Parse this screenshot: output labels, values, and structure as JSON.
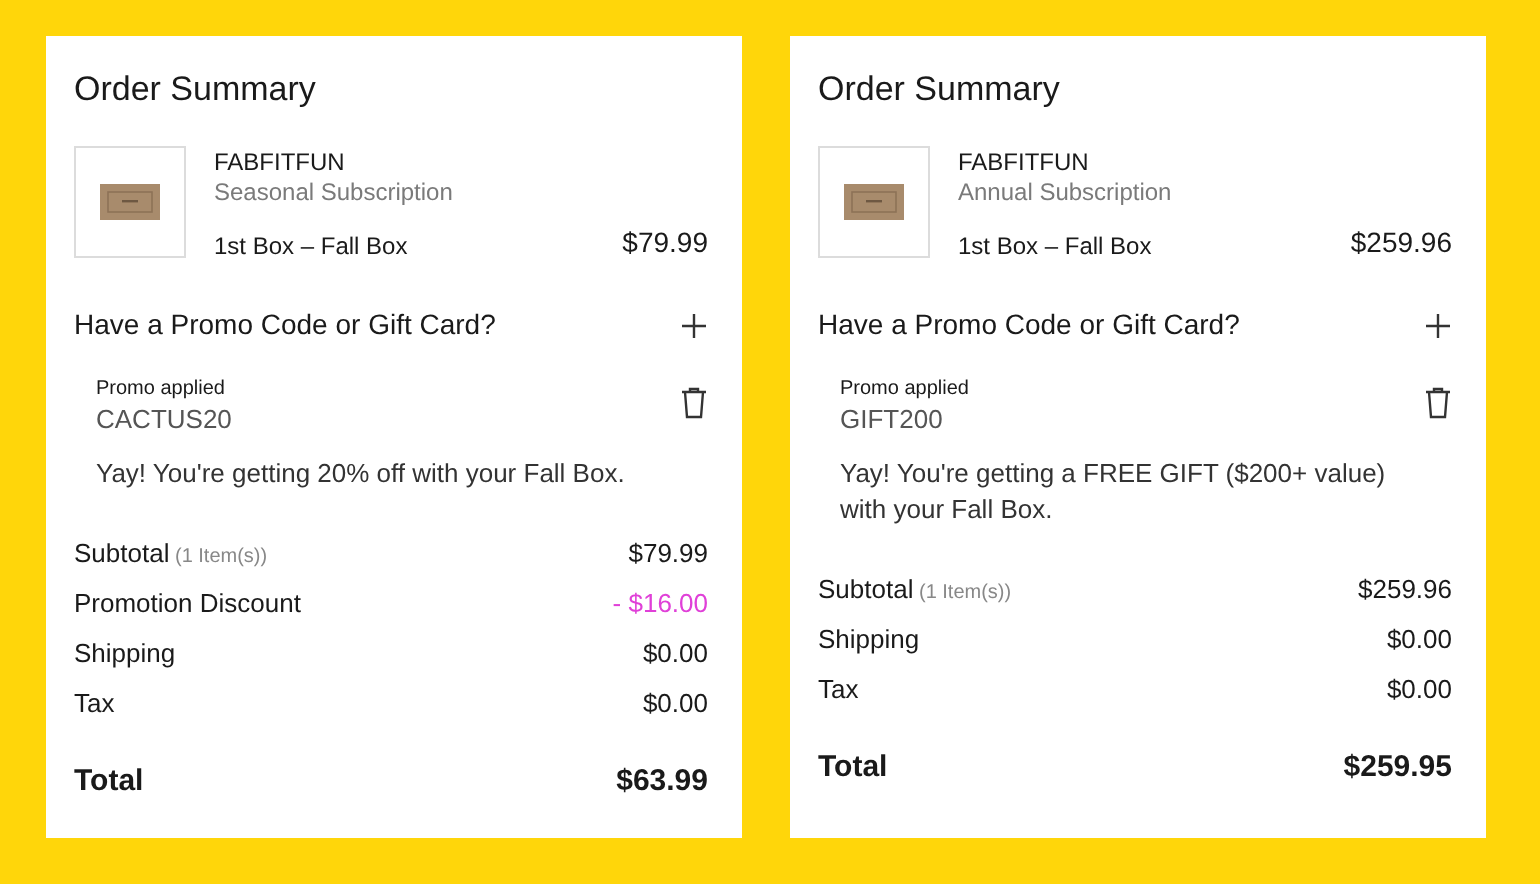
{
  "cards": [
    {
      "title": "Order Summary",
      "brand": "FABFITFUN",
      "plan": "Seasonal Subscription",
      "box": "1st Box – Fall Box",
      "price": "$79.99",
      "promo_prompt": "Have a Promo Code or Gift Card?",
      "promo_label": "Promo applied",
      "promo_code": "CACTUS20",
      "message": "Yay! You're getting 20% off with your Fall Box.",
      "lines": [
        {
          "kind": "normal",
          "label": "Subtotal",
          "note": "(1 Item(s))",
          "value": "$79.99"
        },
        {
          "kind": "discount",
          "label": "Promotion Discount",
          "value": "- $16.00"
        },
        {
          "kind": "normal",
          "label": "Shipping",
          "value": "$0.00"
        },
        {
          "kind": "normal",
          "label": "Tax",
          "value": "$0.00"
        }
      ],
      "total_label": "Total",
      "total": "$63.99"
    },
    {
      "title": "Order Summary",
      "brand": "FABFITFUN",
      "plan": "Annual Subscription",
      "box": "1st Box – Fall Box",
      "price": "$259.96",
      "promo_prompt": "Have a Promo Code or Gift Card?",
      "promo_label": "Promo applied",
      "promo_code": "GIFT200",
      "message": "Yay! You're getting a FREE GIFT ($200+ value) with your Fall Box.",
      "lines": [
        {
          "kind": "normal",
          "label": "Subtotal",
          "note": "(1 Item(s))",
          "value": "$259.96"
        },
        {
          "kind": "normal",
          "label": "Shipping",
          "value": "$0.00"
        },
        {
          "kind": "normal",
          "label": "Tax",
          "value": "$0.00"
        }
      ],
      "total_label": "Total",
      "total": "$259.95"
    }
  ]
}
